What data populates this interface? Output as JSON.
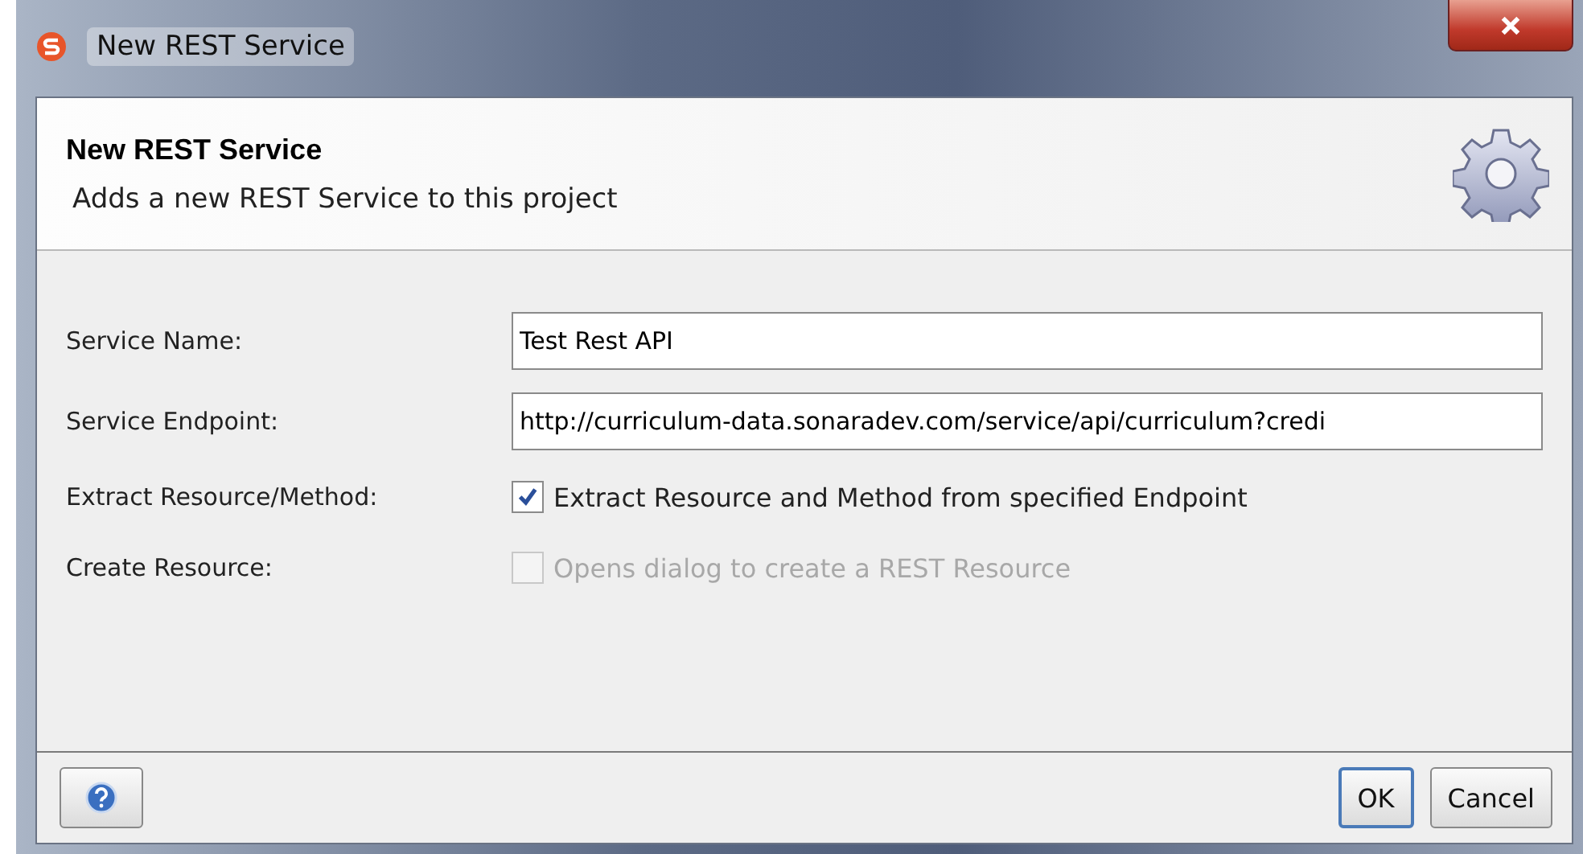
{
  "window": {
    "title": "New REST Service"
  },
  "header": {
    "title": "New REST Service",
    "description": "Adds a new REST Service to this project"
  },
  "fields": [
    {
      "kind": "text",
      "label": "Service Name:",
      "value": "Test Rest API"
    },
    {
      "kind": "text",
      "label": "Service Endpoint:",
      "value": "http://curriculum-data.sonaradev.com/service/api/curriculum?credi"
    },
    {
      "kind": "checkbox",
      "label": "Extract Resource/Method:",
      "text": "Extract Resource and Method from specified Endpoint",
      "checked": true,
      "disabled": false
    },
    {
      "kind": "checkbox",
      "label": "Create Resource:",
      "text": "Opens dialog to create a REST Resource",
      "checked": false,
      "disabled": true
    }
  ],
  "buttons": [
    {
      "label": "OK",
      "default": true
    },
    {
      "label": "Cancel",
      "default": false
    }
  ]
}
